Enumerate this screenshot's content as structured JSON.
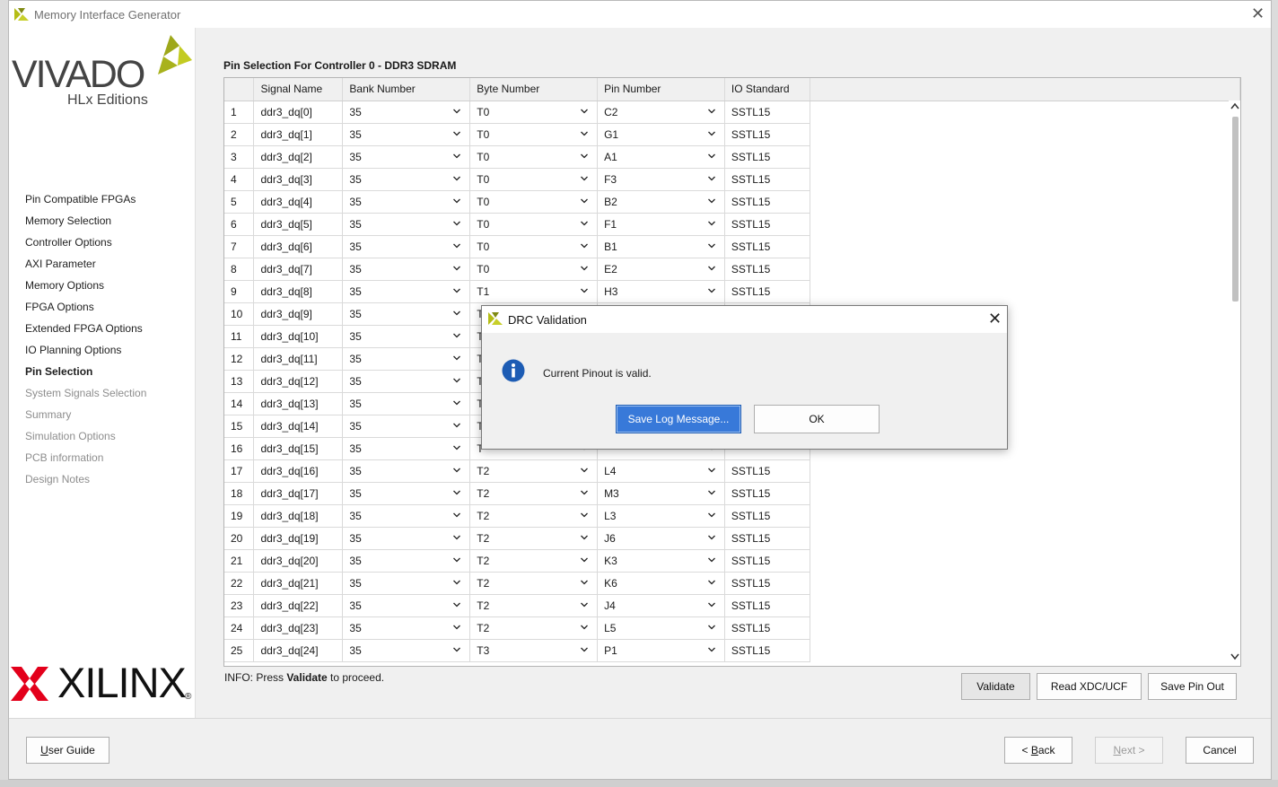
{
  "window": {
    "title": "Memory Interface Generator",
    "close_icon": "close-icon"
  },
  "brand": {
    "vivado": "VIVADO",
    "hlx": "HLx Editions",
    "xilinx": "XILINX",
    "registered": "®",
    "accent": "#b5bd16"
  },
  "sidebar": {
    "items": [
      {
        "label": "Pin Compatible FPGAs",
        "state": "done"
      },
      {
        "label": "Memory Selection",
        "state": "done"
      },
      {
        "label": "Controller Options",
        "state": "done"
      },
      {
        "label": "AXI Parameter",
        "state": "done"
      },
      {
        "label": "Memory Options",
        "state": "done"
      },
      {
        "label": "FPGA Options",
        "state": "done"
      },
      {
        "label": "Extended FPGA Options",
        "state": "done"
      },
      {
        "label": "IO Planning Options",
        "state": "done"
      },
      {
        "label": "Pin Selection",
        "state": "active"
      },
      {
        "label": "System Signals Selection",
        "state": "future"
      },
      {
        "label": "Summary",
        "state": "future"
      },
      {
        "label": "Simulation Options",
        "state": "future"
      },
      {
        "label": "PCB information",
        "state": "future"
      },
      {
        "label": "Design Notes",
        "state": "future"
      }
    ]
  },
  "main": {
    "title": "Pin Selection For Controller 0 - DDR3 SDRAM",
    "columns": [
      "",
      "Signal Name",
      "Bank Number",
      "Byte Number",
      "Pin Number",
      "IO Standard"
    ],
    "rows": [
      [
        "1",
        "ddr3_dq[0]",
        "35",
        "T0",
        "C2",
        "SSTL15"
      ],
      [
        "2",
        "ddr3_dq[1]",
        "35",
        "T0",
        "G1",
        "SSTL15"
      ],
      [
        "3",
        "ddr3_dq[2]",
        "35",
        "T0",
        "A1",
        "SSTL15"
      ],
      [
        "4",
        "ddr3_dq[3]",
        "35",
        "T0",
        "F3",
        "SSTL15"
      ],
      [
        "5",
        "ddr3_dq[4]",
        "35",
        "T0",
        "B2",
        "SSTL15"
      ],
      [
        "6",
        "ddr3_dq[5]",
        "35",
        "T0",
        "F1",
        "SSTL15"
      ],
      [
        "7",
        "ddr3_dq[6]",
        "35",
        "T0",
        "B1",
        "SSTL15"
      ],
      [
        "8",
        "ddr3_dq[7]",
        "35",
        "T0",
        "E2",
        "SSTL15"
      ],
      [
        "9",
        "ddr3_dq[8]",
        "35",
        "T1",
        "H3",
        "SSTL15"
      ],
      [
        "10",
        "ddr3_dq[9]",
        "35",
        "T",
        "",
        ""
      ],
      [
        "11",
        "ddr3_dq[10]",
        "35",
        "T",
        "",
        ""
      ],
      [
        "12",
        "ddr3_dq[11]",
        "35",
        "T",
        "",
        ""
      ],
      [
        "13",
        "ddr3_dq[12]",
        "35",
        "T",
        "",
        ""
      ],
      [
        "14",
        "ddr3_dq[13]",
        "35",
        "T",
        "",
        ""
      ],
      [
        "15",
        "ddr3_dq[14]",
        "35",
        "T",
        "",
        ""
      ],
      [
        "16",
        "ddr3_dq[15]",
        "35",
        "T",
        "",
        ""
      ],
      [
        "17",
        "ddr3_dq[16]",
        "35",
        "T2",
        "L4",
        "SSTL15"
      ],
      [
        "18",
        "ddr3_dq[17]",
        "35",
        "T2",
        "M3",
        "SSTL15"
      ],
      [
        "19",
        "ddr3_dq[18]",
        "35",
        "T2",
        "L3",
        "SSTL15"
      ],
      [
        "20",
        "ddr3_dq[19]",
        "35",
        "T2",
        "J6",
        "SSTL15"
      ],
      [
        "21",
        "ddr3_dq[20]",
        "35",
        "T2",
        "K3",
        "SSTL15"
      ],
      [
        "22",
        "ddr3_dq[21]",
        "35",
        "T2",
        "K6",
        "SSTL15"
      ],
      [
        "23",
        "ddr3_dq[22]",
        "35",
        "T2",
        "J4",
        "SSTL15"
      ],
      [
        "24",
        "ddr3_dq[23]",
        "35",
        "T2",
        "L5",
        "SSTL15"
      ],
      [
        "25",
        "ddr3_dq[24]",
        "35",
        "T3",
        "P1",
        "SSTL15"
      ]
    ],
    "info_prefix": "INFO: Press ",
    "info_bold": "Validate",
    "info_suffix": " to proceed.",
    "buttons": {
      "validate": "Validate",
      "read_xdc": "Read XDC/UCF",
      "save_pinout": "Save Pin Out"
    }
  },
  "footer": {
    "user_guide": {
      "u": "U",
      "rest": "ser Guide"
    },
    "back": {
      "pre": "< ",
      "u": "B",
      "rest": "ack"
    },
    "next": {
      "u": "N",
      "rest": "ext >"
    },
    "cancel": "Cancel"
  },
  "dialog": {
    "title": "DRC Validation",
    "message": "Current Pinout is valid.",
    "save_label": "Save Log Message...",
    "ok_label": "OK",
    "icon": "info-icon",
    "accent": "#3879d9"
  }
}
